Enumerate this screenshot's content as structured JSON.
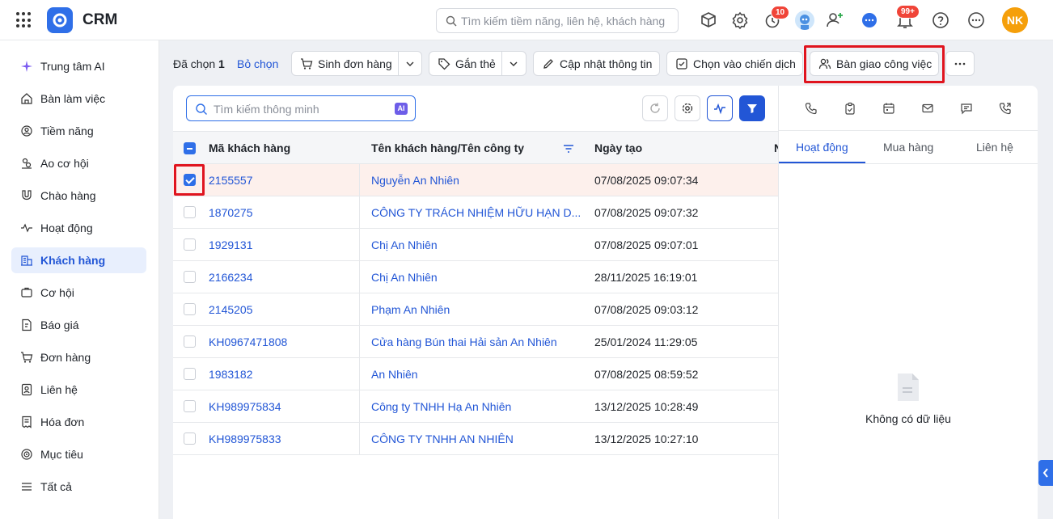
{
  "app": {
    "title": "CRM"
  },
  "header": {
    "search_placeholder": "Tìm kiếm tiềm năng, liên hệ, khách hàng",
    "reminder_badge": "10",
    "notification_badge": "99+",
    "user_initials": "NK"
  },
  "sidebar": {
    "items": [
      {
        "label": "Trung tâm AI",
        "icon": "sparkle-icon"
      },
      {
        "label": "Bàn làm việc",
        "icon": "home-icon"
      },
      {
        "label": "Tiềm năng",
        "icon": "prospect-icon"
      },
      {
        "label": "Ao cơ hội",
        "icon": "pool-icon"
      },
      {
        "label": "Chào hàng",
        "icon": "magnet-icon"
      },
      {
        "label": "Hoạt động",
        "icon": "activity-icon"
      },
      {
        "label": "Khách hàng",
        "icon": "building-icon"
      },
      {
        "label": "Cơ hội",
        "icon": "opportunity-icon"
      },
      {
        "label": "Báo giá",
        "icon": "quote-icon"
      },
      {
        "label": "Đơn hàng",
        "icon": "cart-icon"
      },
      {
        "label": "Liên hệ",
        "icon": "contact-icon"
      },
      {
        "label": "Hóa đơn",
        "icon": "invoice-icon"
      },
      {
        "label": "Mục tiêu",
        "icon": "target-icon"
      },
      {
        "label": "Tất cả",
        "icon": "menu-icon"
      }
    ],
    "active": "Khách hàng"
  },
  "actions": {
    "selected_prefix": "Đã chọn",
    "selected_count": "1",
    "deselect": "Bỏ chọn",
    "create_order": "Sinh đơn hàng",
    "tag": "Gắn thẻ",
    "update_info": "Cập nhật thông tin",
    "add_to_campaign": "Chọn vào chiến dịch",
    "handover": "Bàn giao công việc"
  },
  "table": {
    "search_placeholder": "Tìm kiếm thông minh",
    "ai_label": "AI",
    "columns": [
      "Mã khách hàng",
      "Tên khách hàng/Tên công ty",
      "Ngày tạo",
      "N"
    ],
    "rows": [
      {
        "code": "2155557",
        "name": "Nguyễn An Nhiên",
        "created": "07/08/2025 09:07:34",
        "checked": true
      },
      {
        "code": "1870275",
        "name": "CÔNG TY TRÁCH NHIỆM HỮU HẠN D...",
        "created": "07/08/2025 09:07:32",
        "checked": false
      },
      {
        "code": "1929131",
        "name": "Chị An Nhiên",
        "created": "07/08/2025 09:07:01",
        "checked": false
      },
      {
        "code": "2166234",
        "name": "Chị An Nhiên",
        "created": "28/11/2025 16:19:01",
        "checked": false
      },
      {
        "code": "2145205",
        "name": "Phạm An Nhiên",
        "created": "07/08/2025 09:03:12",
        "checked": false
      },
      {
        "code": "KH0967471808",
        "name": "Cửa hàng Bún thai Hải sản An Nhiên",
        "created": "25/01/2024 11:29:05",
        "checked": false
      },
      {
        "code": "1983182",
        "name": "An Nhiên",
        "created": "07/08/2025 08:59:52",
        "checked": false
      },
      {
        "code": "KH989975834",
        "name": "Công ty TNHH Hạ An Nhiên",
        "created": "13/12/2025 10:28:49",
        "checked": false
      },
      {
        "code": "KH989975833",
        "name": "CÔNG TY TNHH AN NHIÊN",
        "created": "13/12/2025 10:27:10",
        "checked": false
      }
    ]
  },
  "detail_panel": {
    "tabs": [
      "Hoạt động",
      "Mua hàng",
      "Liên hệ"
    ],
    "active_tab": "Hoạt động",
    "empty_text": "Không có dữ liệu",
    "quick_icons": [
      "phone-icon",
      "task-icon",
      "calendar-icon",
      "mail-icon",
      "message-icon",
      "call-log-icon"
    ]
  },
  "colors": {
    "primary": "#2256d6",
    "highlight": "#e0141e",
    "selected_row": "#fdf0ec",
    "avatar": "#f59f0a"
  }
}
